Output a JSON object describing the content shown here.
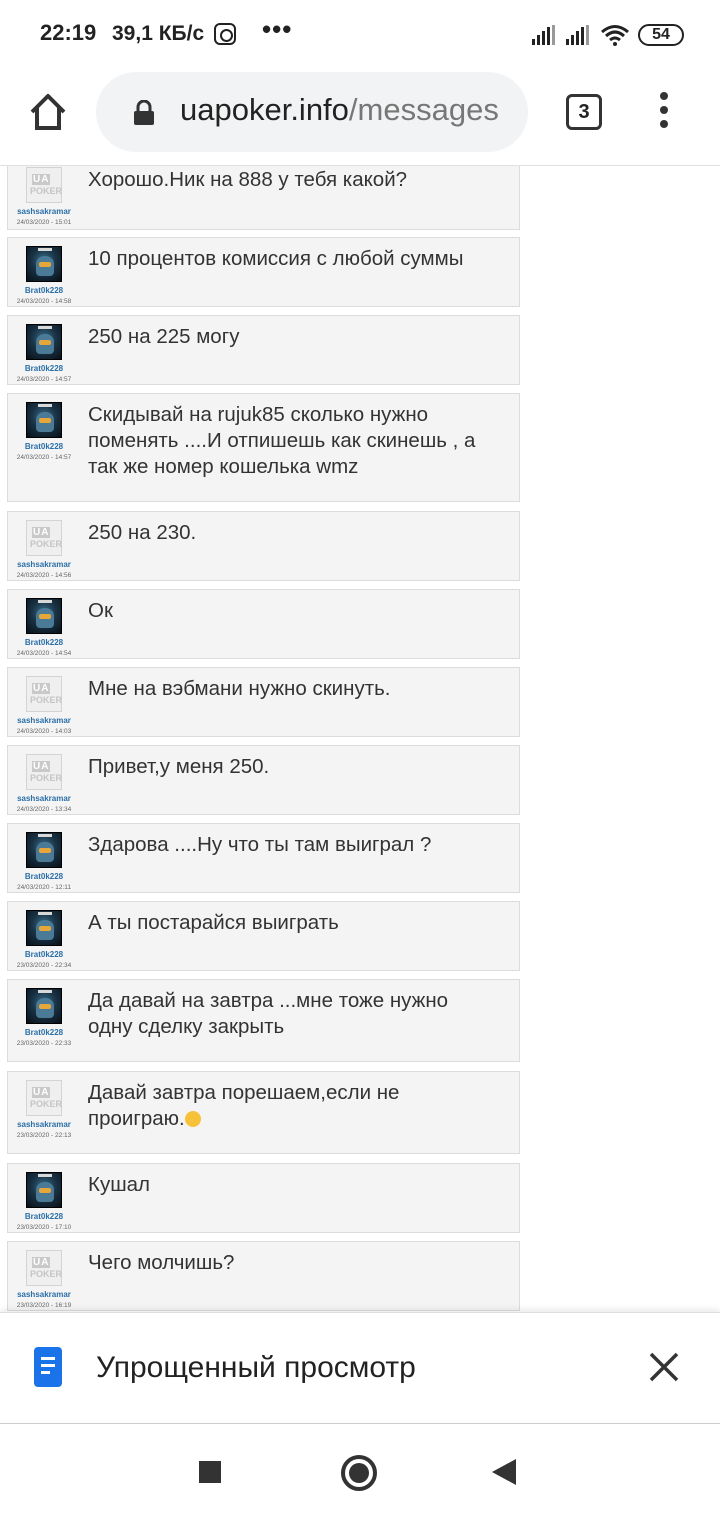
{
  "status_bar": {
    "time": "22:19",
    "speed": "39,1 КБ/с",
    "more": "•••",
    "battery": "54"
  },
  "browser": {
    "url_domain": "uapoker.info",
    "url_path": "/messages",
    "tab_count": "3"
  },
  "messages": [
    {
      "user": "sashsakramar",
      "date": "24/03/2020 - 15:01",
      "text": "Хорошо.Ник на 888 у тебя какой?",
      "avatar": "ua"
    },
    {
      "user": "Brat0k228",
      "date": "24/03/2020 - 14:58",
      "text": "10 процентов комиссия с любой суммы",
      "avatar": "sc"
    },
    {
      "user": "Brat0k228",
      "date": "24/03/2020 - 14:57",
      "text": "250 на 225 могу",
      "avatar": "sc"
    },
    {
      "user": "Brat0k228",
      "date": "24/03/2020 - 14:57",
      "text": "Скидывай на rujuk85 сколько нужно поменять ....И отпишешь как скинешь , а так же номер кошелька wmz",
      "avatar": "sc"
    },
    {
      "user": "sashsakramar",
      "date": "24/03/2020 - 14:56",
      "text": "250 на 230.",
      "avatar": "ua"
    },
    {
      "user": "Brat0k228",
      "date": "24/03/2020 - 14:54",
      "text": "Ок",
      "avatar": "sc"
    },
    {
      "user": "sashsakramar",
      "date": "24/03/2020 - 14:03",
      "text": "Мне на вэбмани нужно скинуть.",
      "avatar": "ua"
    },
    {
      "user": "sashsakramar",
      "date": "24/03/2020 - 13:34",
      "text": "Привет,у меня 250.",
      "avatar": "ua"
    },
    {
      "user": "Brat0k228",
      "date": "24/03/2020 - 12:11",
      "text": "Здарова ....Ну что ты там выиграл ?",
      "avatar": "sc"
    },
    {
      "user": "Brat0k228",
      "date": "23/03/2020 - 22:34",
      "text": "А ты постарайся выиграть",
      "avatar": "sc"
    },
    {
      "user": "Brat0k228",
      "date": "23/03/2020 - 22:33",
      "text": "Да давай на завтра ...мне тоже нужно одну сделку закрыть",
      "avatar": "sc"
    },
    {
      "user": "sashsakramar",
      "date": "23/03/2020 - 22:13",
      "text": "Давай завтра порешаем,если не проиграю.",
      "avatar": "ua"
    },
    {
      "user": "Brat0k228",
      "date": "23/03/2020 - 17:10",
      "text": "Кушал",
      "avatar": "sc"
    },
    {
      "user": "sashsakramar",
      "date": "23/03/2020 - 16:19",
      "text": "Чего молчишь?",
      "avatar": "ua"
    }
  ],
  "ua_logo": {
    "top": "UA",
    "bottom": "POKER"
  },
  "reader_mode": {
    "label": "Упрощенный просмотр"
  }
}
